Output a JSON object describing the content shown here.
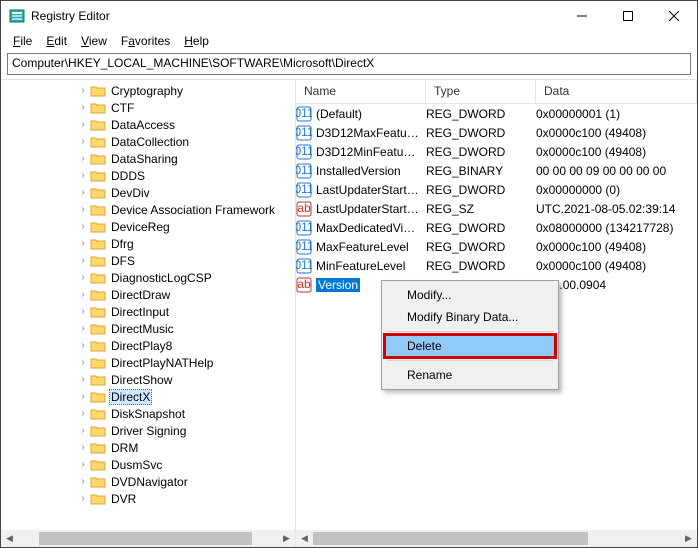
{
  "window": {
    "title": "Registry Editor"
  },
  "menu": {
    "file": "File",
    "edit": "Edit",
    "view": "View",
    "favorites": "Favorites",
    "help": "Help"
  },
  "address": "Computer\\HKEY_LOCAL_MACHINE\\SOFTWARE\\Microsoft\\DirectX",
  "tree": {
    "items": [
      "Cryptography",
      "CTF",
      "DataAccess",
      "DataCollection",
      "DataSharing",
      "DDDS",
      "DevDiv",
      "Device Association Framework",
      "DeviceReg",
      "Dfrg",
      "DFS",
      "DiagnosticLogCSP",
      "DirectDraw",
      "DirectInput",
      "DirectMusic",
      "DirectPlay8",
      "DirectPlayNATHelp",
      "DirectShow",
      "DirectX",
      "DiskSnapshot",
      "Driver Signing",
      "DRM",
      "DusmSvc",
      "DVDNavigator",
      "DVR"
    ],
    "selectedIndex": 18
  },
  "columns": {
    "name": "Name",
    "type": "Type",
    "data": "Data"
  },
  "values": [
    {
      "icon": "dword",
      "name": "(Default)",
      "type": "REG_DWORD",
      "data": "0x00000001 (1)"
    },
    {
      "icon": "dword",
      "name": "D3D12MaxFeatu…",
      "type": "REG_DWORD",
      "data": "0x0000c100 (49408)"
    },
    {
      "icon": "dword",
      "name": "D3D12MinFeatu…",
      "type": "REG_DWORD",
      "data": "0x0000c100 (49408)"
    },
    {
      "icon": "dword",
      "name": "InstalledVersion",
      "type": "REG_BINARY",
      "data": "00 00 00 09 00 00 00 00"
    },
    {
      "icon": "dword",
      "name": "LastUpdaterStart…",
      "type": "REG_DWORD",
      "data": "0x00000000 (0)"
    },
    {
      "icon": "sz",
      "name": "LastUpdaterStart…",
      "type": "REG_SZ",
      "data": "UTC.2021-08-05.02:39:14"
    },
    {
      "icon": "dword",
      "name": "MaxDedicatedVi…",
      "type": "REG_DWORD",
      "data": "0x08000000 (134217728)"
    },
    {
      "icon": "dword",
      "name": "MaxFeatureLevel",
      "type": "REG_DWORD",
      "data": "0x0000c100 (49408)"
    },
    {
      "icon": "dword",
      "name": "MinFeatureLevel",
      "type": "REG_DWORD",
      "data": "0x0000c100 (49408)"
    },
    {
      "icon": "sz",
      "name": "Version",
      "type": "REG_SZ",
      "data": "4.09.00.0904",
      "selected": true
    }
  ],
  "context": {
    "modify": "Modify...",
    "modifyBinary": "Modify Binary Data...",
    "delete": "Delete",
    "rename": "Rename"
  }
}
